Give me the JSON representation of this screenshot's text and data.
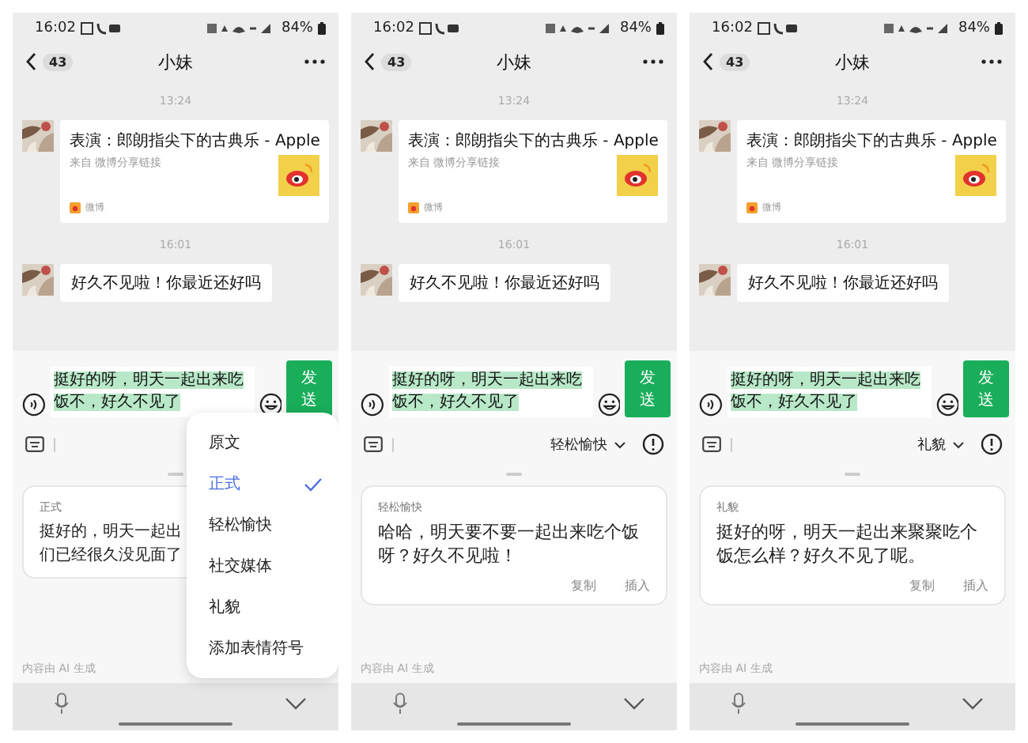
{
  "phones": [
    {
      "status_bar": {
        "time": "16:02",
        "battery": "84%"
      },
      "header": {
        "unread": "43",
        "title": "小妹"
      },
      "messages": [
        {
          "kind": "time",
          "text": "13:24"
        },
        {
          "kind": "link_card",
          "title": "表演：郎朗指尖下的古典乐 - Apple",
          "source": "来自 微博分享链接",
          "app": "微博"
        },
        {
          "kind": "time",
          "text": "16:01"
        },
        {
          "kind": "text",
          "text": "好久不见啦！你最近还好吗"
        }
      ],
      "composer": {
        "text": "挺好的呀，明天一起出来吃饭不，好久不见了",
        "send": "发送"
      },
      "result": {
        "label": "正式",
        "lines": [
          "挺好的，明天一起出",
          "们已经很久没见面了"
        ]
      },
      "note": "内容由 AI 生成",
      "menu": {
        "items": [
          {
            "label": "原文",
            "selected": false
          },
          {
            "label": "正式",
            "selected": true
          },
          {
            "label": "轻松愉快",
            "selected": false
          },
          {
            "label": "社交媒体",
            "selected": false
          },
          {
            "label": "礼貌",
            "selected": false
          },
          {
            "label": "添加表情符号",
            "selected": false
          }
        ]
      }
    },
    {
      "status_bar": {
        "time": "16:02",
        "battery": "84%"
      },
      "header": {
        "unread": "43",
        "title": "小妹"
      },
      "messages": [
        {
          "kind": "time",
          "text": "13:24"
        },
        {
          "kind": "link_card",
          "title": "表演：郎朗指尖下的古典乐 - Apple",
          "source": "来自 微博分享链接",
          "app": "微博"
        },
        {
          "kind": "time",
          "text": "16:01"
        },
        {
          "kind": "text",
          "text": "好久不见啦！你最近还好吗"
        }
      ],
      "composer": {
        "text": "挺好的呀，明天一起出来吃饭不，好久不见了",
        "send": "发送"
      },
      "toolbar": {
        "tone": "轻松愉快"
      },
      "result": {
        "label": "轻松愉快",
        "lines": [
          "哈哈，明天要不要一起出来吃个饭呀？好久不见啦！"
        ],
        "actions": [
          "复制",
          "插入"
        ]
      },
      "note": "内容由 AI 生成"
    },
    {
      "status_bar": {
        "time": "16:02",
        "battery": "84%"
      },
      "header": {
        "unread": "43",
        "title": "小妹"
      },
      "messages": [
        {
          "kind": "time",
          "text": "13:24"
        },
        {
          "kind": "link_card",
          "title": "表演：郎朗指尖下的古典乐 - Apple",
          "source": "来自 微博分享链接",
          "app": "微博"
        },
        {
          "kind": "time",
          "text": "16:01"
        },
        {
          "kind": "text",
          "text": "好久不见啦！你最近还好吗"
        }
      ],
      "composer": {
        "text": "挺好的呀，明天一起出来吃饭不，好久不见了",
        "send": "发送"
      },
      "toolbar": {
        "tone": "礼貌"
      },
      "result": {
        "label": "礼貌",
        "lines": [
          "挺好的呀，明天一起出来聚聚吃个饭怎么样？好久不见了呢。"
        ],
        "actions": [
          "复制",
          "插入"
        ]
      },
      "note": "内容由 AI 生成"
    }
  ]
}
